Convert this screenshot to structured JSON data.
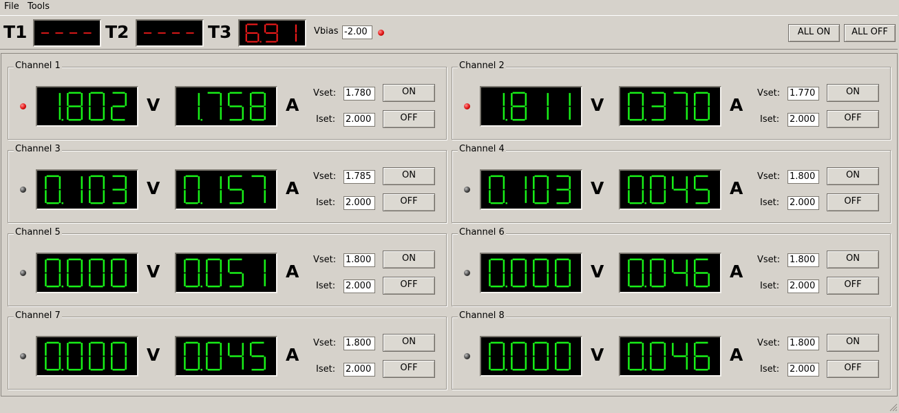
{
  "menu": {
    "file": "File",
    "tools": "Tools"
  },
  "toolbar": {
    "temps": [
      {
        "label": "T1",
        "display": "----"
      },
      {
        "label": "T2",
        "display": "----"
      },
      {
        "label": "T3",
        "display": "6.91"
      }
    ],
    "vbias_label": "Vbias",
    "vbias_value": "-2.00",
    "all_on_label": "ALL ON",
    "all_off_label": "ALL OFF"
  },
  "channels": [
    {
      "title": "Channel 1",
      "voltage": "1.802",
      "current": "1.758",
      "vset": "1.780",
      "iset": "2.000",
      "led": "red"
    },
    {
      "title": "Channel 2",
      "voltage": "1.811",
      "current": "0.370",
      "vset": "1.770",
      "iset": "2.000",
      "led": "red"
    },
    {
      "title": "Channel 3",
      "voltage": "0.103",
      "current": "0.157",
      "vset": "1.785",
      "iset": "2.000",
      "led": "dark"
    },
    {
      "title": "Channel 4",
      "voltage": "0.103",
      "current": "0.045",
      "vset": "1.800",
      "iset": "2.000",
      "led": "dark"
    },
    {
      "title": "Channel 5",
      "voltage": "0.000",
      "current": "0.051",
      "vset": "1.800",
      "iset": "2.000",
      "led": "dark"
    },
    {
      "title": "Channel 6",
      "voltage": "0.000",
      "current": "0.046",
      "vset": "1.800",
      "iset": "2.000",
      "led": "dark"
    },
    {
      "title": "Channel 7",
      "voltage": "0.000",
      "current": "0.045",
      "vset": "1.800",
      "iset": "2.000",
      "led": "dark"
    },
    {
      "title": "Channel 8",
      "voltage": "0.000",
      "current": "0.046",
      "vset": "1.800",
      "iset": "2.000",
      "led": "dark"
    }
  ],
  "labels": {
    "volt_unit": "V",
    "amp_unit": "A",
    "vset_label": "Vset:",
    "iset_label": "Iset:",
    "on_label": "ON",
    "off_label": "OFF"
  },
  "colors": {
    "lcd_green": "#18f018",
    "lcd_red": "#ee1a1a",
    "led_red": "#e01010",
    "led_dark": "#404040",
    "background": "#d6d2cb"
  },
  "icons": {
    "status_led": "led-indicator-icon",
    "resize_grip": "resize-grip-icon"
  }
}
